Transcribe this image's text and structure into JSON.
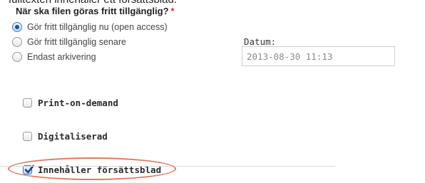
{
  "context": {
    "cut_caption": "fulltexten innehåller ett försättsblad."
  },
  "availability": {
    "question": "När ska filen göras fritt tillgänglig?",
    "required_marker": "*",
    "options": [
      {
        "label": "Gör fritt tillgänglig nu (open access)",
        "selected": true
      },
      {
        "label": "Gör fritt tillgänglig senare",
        "selected": false
      },
      {
        "label": "Endast arkivering",
        "selected": false
      }
    ],
    "date_label": "Datum:",
    "date_value": "2013-08-30 11:13"
  },
  "checkboxes": [
    {
      "label": "Print-on-demand",
      "checked": false
    },
    {
      "label": "Digitaliserad",
      "checked": false
    },
    {
      "label": "Innehåller försättsblad",
      "checked": true
    }
  ],
  "colors": {
    "required": "#d6332f",
    "highlight": "#e07a5f",
    "radio_selected": "#1d4f9a"
  }
}
